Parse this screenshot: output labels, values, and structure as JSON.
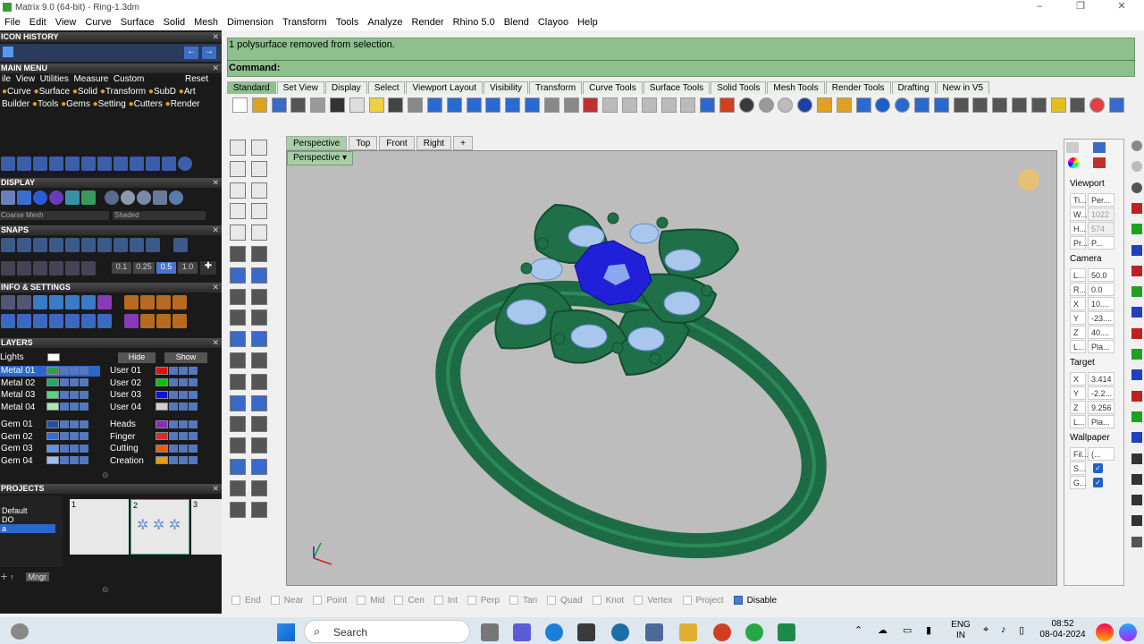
{
  "window": {
    "title": "Matrix 9.0 (64-bit) - Ring-1.3dm",
    "controls": [
      "–",
      "❐",
      "✕"
    ]
  },
  "menu": [
    "File",
    "Edit",
    "View",
    "Curve",
    "Surface",
    "Solid",
    "Mesh",
    "Dimension",
    "Transform",
    "Tools",
    "Analyze",
    "Render",
    "Rhino 5.0",
    "Blend",
    "Clayoo",
    "Help"
  ],
  "left_panel": {
    "icon_history": "ICON HISTORY",
    "main_menu": "MAIN MENU",
    "main_menu_row1": [
      "ile",
      "View",
      "Utilities",
      "Measure",
      "Custom",
      "Reset"
    ],
    "main_menu_row2": [
      "Curve",
      "Surface",
      "Solid",
      "Transform",
      "SubD",
      "Art"
    ],
    "main_menu_row3": [
      "Builder",
      "Tools",
      "Gems",
      "Setting",
      "Cutters",
      "Render"
    ],
    "display": "DISPLAY",
    "display_mesh": "Coarse Mesh",
    "display_shade": "Shaded",
    "snaps": "SNAPS",
    "snap_values": [
      "0.1",
      "0.25",
      "0.5",
      "1.0"
    ],
    "info_settings": "INFO & SETTINGS",
    "layers": "LAYERS",
    "layers_hide": "Hide",
    "layers_show": "Show",
    "lights": "Lights",
    "layers_left": [
      {
        "name": "Metal 01",
        "color": "#2e9e4f",
        "selected": true
      },
      {
        "name": "Metal 02",
        "color": "#23a86b",
        "selected": false
      },
      {
        "name": "Metal 03",
        "color": "#5dd27d",
        "selected": false
      },
      {
        "name": "Metal 04",
        "color": "#a8e8b0",
        "selected": false
      },
      {
        "name": "Gem 01",
        "color": "#1e4fa8",
        "selected": false
      },
      {
        "name": "Gem 02",
        "color": "#2f6ed8",
        "selected": false
      },
      {
        "name": "Gem 03",
        "color": "#5b95e8",
        "selected": false
      },
      {
        "name": "Gem 04",
        "color": "#9cc0f2",
        "selected": false
      }
    ],
    "layers_right": [
      {
        "name": "User 01",
        "color": "#e01010"
      },
      {
        "name": "User 02",
        "color": "#10c010"
      },
      {
        "name": "User 03",
        "color": "#1010e0"
      },
      {
        "name": "User 04",
        "color": "#d0d0d0"
      },
      {
        "name": "Heads",
        "color": "#8a2ac0"
      },
      {
        "name": "Finger",
        "color": "#d03030"
      },
      {
        "name": "Cutting",
        "color": "#e06010"
      },
      {
        "name": "Creation",
        "color": "#e0a010"
      }
    ],
    "projects": "PROJECTS",
    "project_items": [
      "Default",
      "DO",
      "a"
    ],
    "project_thumbs": [
      "1",
      "2",
      "3"
    ],
    "mngr": "Mngr"
  },
  "command": {
    "history": "1 polysurface removed from selection.",
    "prompt": "Command:"
  },
  "toolbar_tabs": [
    "Standard",
    "Set View",
    "Display",
    "Select",
    "Viewport Layout",
    "Visibility",
    "Transform",
    "Curve Tools",
    "Surface Tools",
    "Solid Tools",
    "Mesh Tools",
    "Render Tools",
    "Drafting",
    "New in V5"
  ],
  "viewport_tabs": [
    "Perspective",
    "Top",
    "Front",
    "Right",
    "+"
  ],
  "viewport_label": "Perspective",
  "right_panel": {
    "viewport_title": "Viewport",
    "viewport_rows": [
      {
        "k": "Ti...",
        "v": "Per...",
        "dim": false
      },
      {
        "k": "W...",
        "v": "1022",
        "dim": true
      },
      {
        "k": "H...",
        "v": "574",
        "dim": true
      },
      {
        "k": "Pr...",
        "v": "P...",
        "dim": false
      }
    ],
    "camera_title": "Camera",
    "camera_rows": [
      {
        "k": "L...",
        "v": "50.0"
      },
      {
        "k": "R...",
        "v": "0.0"
      },
      {
        "k": "X",
        "v": "10...."
      },
      {
        "k": "Y",
        "v": "-23...."
      },
      {
        "k": "Z",
        "v": "40...."
      },
      {
        "k": "L...",
        "v": "Pla..."
      }
    ],
    "target_title": "Target",
    "target_rows": [
      {
        "k": "X",
        "v": "3.414"
      },
      {
        "k": "Y",
        "v": "-2.2..."
      },
      {
        "k": "Z",
        "v": "9.256"
      },
      {
        "k": "L...",
        "v": "Pla..."
      }
    ],
    "wallpaper_title": "Wallpaper",
    "wallpaper_rows": [
      {
        "k": "Fil...",
        "v": "(..."
      },
      {
        "k": "S...",
        "v": ""
      },
      {
        "k": "G...",
        "v": ""
      }
    ]
  },
  "osnaps": [
    {
      "label": "End",
      "on": false
    },
    {
      "label": "Near",
      "on": false
    },
    {
      "label": "Point",
      "on": false
    },
    {
      "label": "Mid",
      "on": false
    },
    {
      "label": "Cen",
      "on": false
    },
    {
      "label": "Int",
      "on": false
    },
    {
      "label": "Perp",
      "on": false
    },
    {
      "label": "Tan",
      "on": false
    },
    {
      "label": "Quad",
      "on": false
    },
    {
      "label": "Knot",
      "on": false
    },
    {
      "label": "Vertex",
      "on": false
    },
    {
      "label": "Project",
      "on": false
    },
    {
      "label": "Disable",
      "on": true
    }
  ],
  "taskbar": {
    "search": "Search",
    "lang_top": "ENG",
    "lang_bottom": "IN",
    "time": "08:52",
    "date": "08-04-2024"
  },
  "colors": {
    "ring": "#1d6b45",
    "gem_main": "#2020d8",
    "gem_side": "#a9c7ec",
    "command_bg": "#8ec08e"
  }
}
